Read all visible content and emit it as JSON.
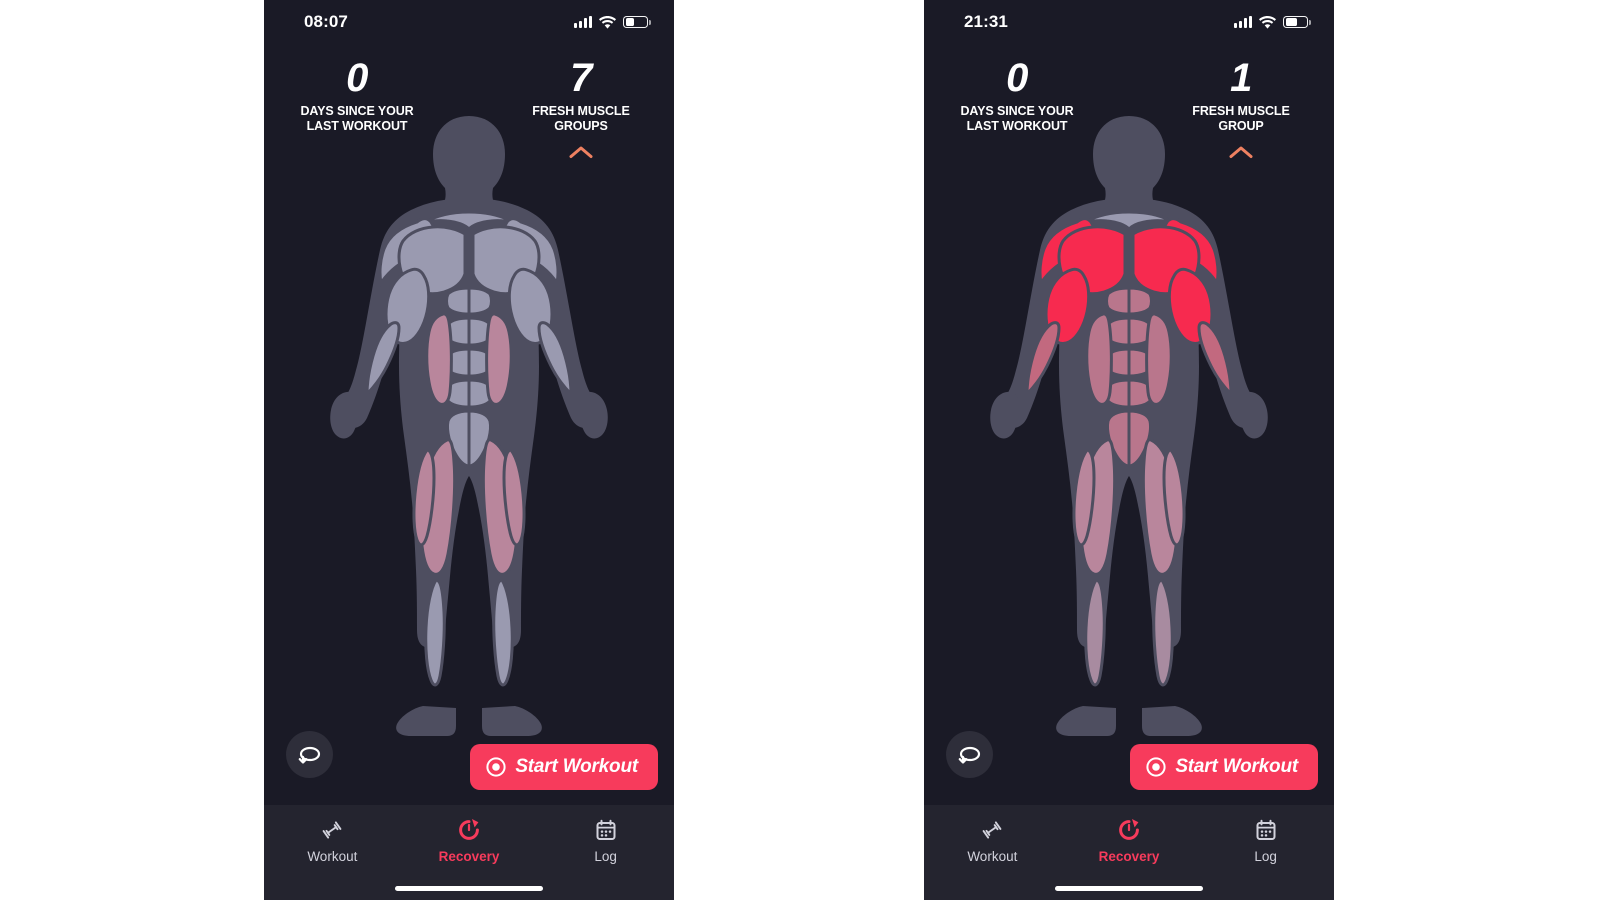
{
  "meta": {
    "app_kind": "fitness-recovery-app",
    "screens": 2
  },
  "colors": {
    "app_background": "#1a1a26",
    "accent_red": "#f73b5c",
    "muscle_fresh_red": "#f72a4f",
    "muscle_partial_pink": "#b9869c",
    "muscle_rested_gray": "#9a9ab0",
    "body_silhouette": "#4e4e60",
    "tabbar_background": "#24242f",
    "chevron_salmon": "#ef8161",
    "text_primary": "#ffffff",
    "text_muted": "#d2d2dc"
  },
  "screens": [
    {
      "id": "screen-left",
      "status": {
        "time": "08:07",
        "signal_icon": "cellular-signal-icon",
        "wifi_icon": "wifi-icon",
        "battery_icon": "battery-icon",
        "battery_level_pct": 35
      },
      "stats": {
        "left": {
          "value": "0",
          "label": "DAYS SINCE YOUR\nLAST WORKOUT"
        },
        "right": {
          "value": "7",
          "label": "FRESH MUSCLE\nGROUPS",
          "chevron_icon": "chevron-up-icon"
        }
      },
      "figure": {
        "view": "front",
        "head_color": "#4e4e60",
        "muscles": {
          "chest": "#9a9ab0",
          "shoulders": "#9a9ab0",
          "biceps": "#9a9ab0",
          "forearms": "#9a9ab0",
          "abs": "#9a9ab0",
          "obliques": "#b9869c",
          "quads": "#b9869c",
          "calves": "#9a9ab0"
        }
      },
      "rotate_button": {
        "icon": "rotate-3d-icon",
        "label": ""
      },
      "start_button": {
        "icon": "record-circle-icon",
        "label": "Start Workout"
      },
      "tabs": [
        {
          "id": "workout",
          "label": "Workout",
          "icon": "dumbbell-icon",
          "active": false
        },
        {
          "id": "recovery",
          "label": "Recovery",
          "icon": "recovery-refresh-icon",
          "active": true
        },
        {
          "id": "log",
          "label": "Log",
          "icon": "calendar-icon",
          "active": false
        }
      ]
    },
    {
      "id": "screen-right",
      "status": {
        "time": "21:31",
        "signal_icon": "cellular-signal-icon",
        "wifi_icon": "wifi-icon",
        "battery_icon": "battery-icon",
        "battery_level_pct": 48
      },
      "stats": {
        "left": {
          "value": "0",
          "label": "DAYS SINCE YOUR\nLAST WORKOUT"
        },
        "right": {
          "value": "1",
          "label": "FRESH MUSCLE\nGROUP",
          "chevron_icon": "chevron-up-icon"
        }
      },
      "figure": {
        "view": "front",
        "head_color": "#4e4e60",
        "muscles": {
          "chest": "#f72a4f",
          "shoulders": "#f72a4f",
          "biceps": "#f72a4f",
          "forearms": "#c2697f",
          "abs": "#b9768c",
          "obliques": "#b9768c",
          "quads": "#b9869c",
          "calves": "#a88ba0"
        }
      },
      "rotate_button": {
        "icon": "rotate-3d-icon",
        "label": ""
      },
      "start_button": {
        "icon": "record-circle-icon",
        "label": "Start Workout"
      },
      "tabs": [
        {
          "id": "workout",
          "label": "Workout",
          "icon": "dumbbell-icon",
          "active": false
        },
        {
          "id": "recovery",
          "label": "Recovery",
          "icon": "recovery-refresh-icon",
          "active": true
        },
        {
          "id": "log",
          "label": "Log",
          "icon": "calendar-icon",
          "active": false
        }
      ]
    }
  ]
}
